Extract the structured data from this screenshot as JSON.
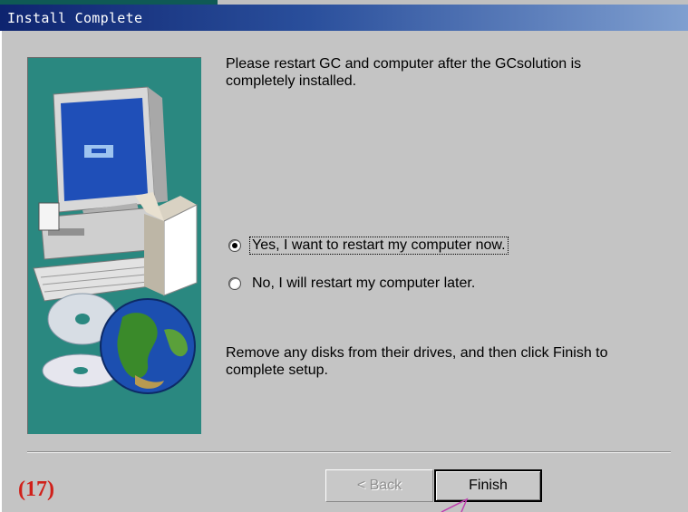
{
  "window": {
    "title": "Install Complete"
  },
  "messages": {
    "restart_note": "Please restart GC and computer after the GCsolution is completely installed.",
    "finish_note": "Remove any disks from their drives, and then click Finish to complete setup."
  },
  "options": [
    {
      "label": "Yes, I want to restart my computer now.",
      "selected": true
    },
    {
      "label": "No, I will restart my computer later.",
      "selected": false
    }
  ],
  "buttons": {
    "back": "< Back",
    "finish": "Finish"
  },
  "annotation": "(17)",
  "colors": {
    "title_bar": "#0e246f",
    "side_panel": "#2a8880",
    "annotation": "#d0201a"
  }
}
